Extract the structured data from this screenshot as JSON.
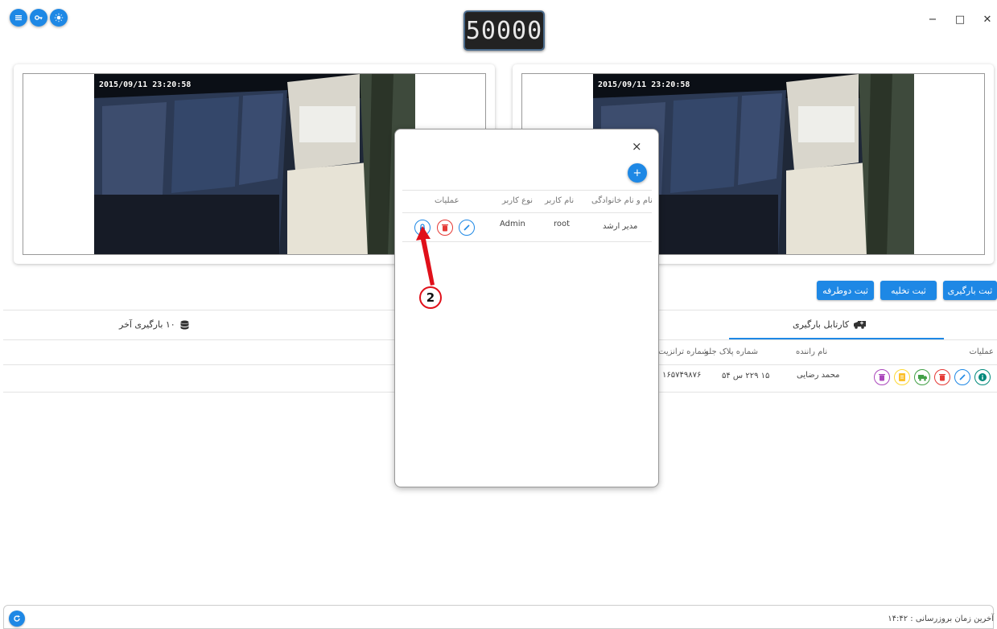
{
  "counter": {
    "value": "50000"
  },
  "top_buttons": [
    {
      "icon": "menu-icon"
    },
    {
      "icon": "key-icon"
    },
    {
      "icon": "brightness-icon"
    }
  ],
  "window_controls": {
    "minimize": "−",
    "maximize": "□",
    "close": "✕"
  },
  "cameras": [
    {
      "timestamp": "2015/09/11 23:20:58"
    },
    {
      "timestamp": "2015/09/11 23:20:58"
    }
  ],
  "actions": {
    "register_loading": "ثبت بارگیری",
    "register_unloading": "ثبت تخلیه",
    "register_two_way": "ثبت دوطرفه"
  },
  "tabs": {
    "cartable": "کارتابل بارگیری",
    "last_loads": "۱۰ بارگیری آخر"
  },
  "main_table": {
    "headers": {
      "operations": "عملیات",
      "driver_name": "نام راننده",
      "front_plate": "شماره پلاک جلو",
      "transit_no": "شماره ترانزیت"
    },
    "row": {
      "driver_name": "محمد رضایی",
      "front_plate": "۱۵ ۲۲۹ س ۵۴",
      "transit_no": "۱۶۵۷۴۹۸۷۶"
    }
  },
  "modal": {
    "close": "×",
    "add": "+",
    "headers": {
      "full_name": "نام و نام خانوادگی",
      "username": "نام کاربر",
      "user_type": "نوع کاربر",
      "operations": "عملیات"
    },
    "row": {
      "full_name": "مدیر ارشد",
      "username": "root",
      "user_type": "Admin"
    }
  },
  "annotation": {
    "number": "2"
  },
  "footer": {
    "last_update": "آخرین زمان بروزرسانی : ۱۴:۴۲"
  },
  "colors": {
    "primary": "#1e88e5",
    "danger": "#e53935",
    "success": "#43a047",
    "warning": "#fdd835",
    "purple": "#8e24aa",
    "teal": "#00897b",
    "annotation_red": "#e0101a"
  }
}
